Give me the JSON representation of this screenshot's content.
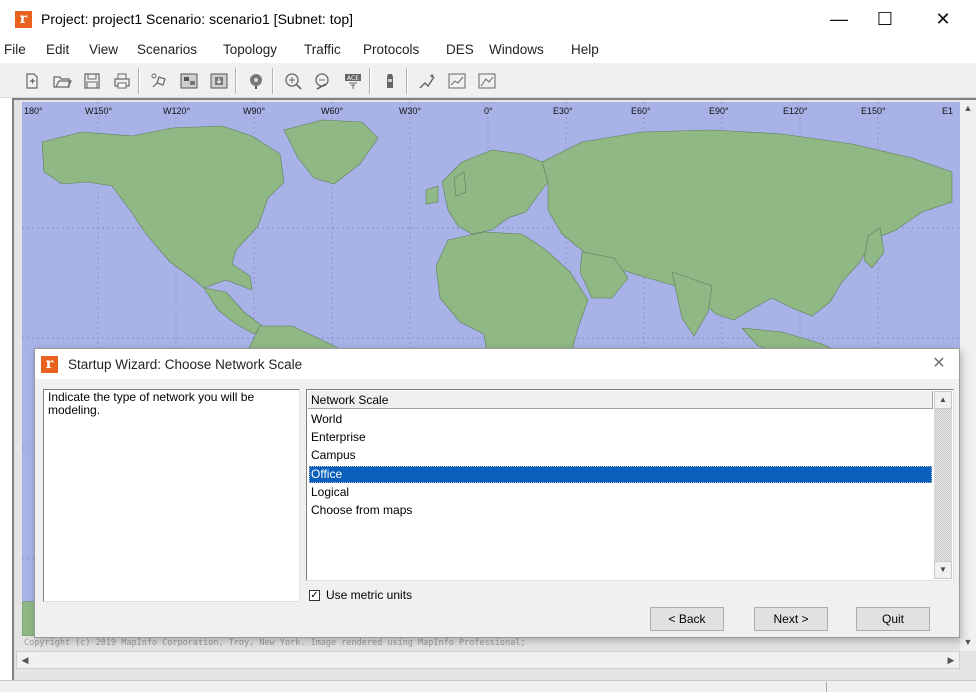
{
  "window": {
    "title": "Project: project1 Scenario: scenario1  [Subnet: top]",
    "logo_glyph": "r",
    "minimize_glyph": "—",
    "maximize_glyph": "☐",
    "close_glyph": "✕"
  },
  "menu": {
    "items": [
      "File",
      "Edit",
      "View",
      "Scenarios",
      "Topology",
      "Traffic",
      "Protocols",
      "DES",
      "Windows",
      "Help"
    ]
  },
  "toolbar": {
    "icons": [
      "new-project-icon",
      "open-folder-icon",
      "save-icon",
      "print-icon",
      "object-palette-icon",
      "configure-traffic-icon",
      "import-icon",
      "check-links-icon",
      "zoom-in-icon",
      "zoom-out-icon",
      "ace-icon",
      "run-simulation-icon",
      "view-results-icon",
      "hide-graphs-icon",
      "show-graphs-icon"
    ]
  },
  "map": {
    "longitude_labels": [
      "180°",
      "W150°",
      "W120°",
      "W90°",
      "W60°",
      "W30°",
      "0°",
      "E30°",
      "E60°",
      "E90°",
      "E120°",
      "E150°",
      "E1"
    ],
    "ocean_color": "#a9b2e6",
    "land_color": "#8fb885",
    "copyright": "Copyright (c) 2019 MapInfo Corporation, Troy, New York. Image rendered using MapInfo Professional;"
  },
  "dialog": {
    "title": "Startup Wizard: Choose Network Scale",
    "close_glyph": "✕",
    "description": "Indicate the type of network you will be modeling.",
    "list_header": "Network Scale",
    "options": [
      "World",
      "Enterprise",
      "Campus",
      "Office",
      "Logical",
      "Choose from maps"
    ],
    "selected_option": "Office",
    "metric_checked": "✓",
    "metric_label": "Use metric units",
    "buttons": {
      "back": "< Back",
      "next": "Next >",
      "quit": "Quit"
    },
    "selection_color": "#0a5fbc"
  }
}
